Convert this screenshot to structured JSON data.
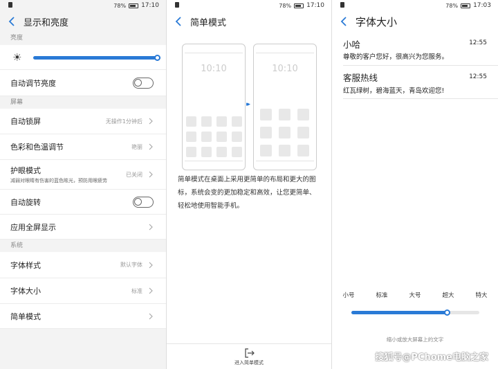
{
  "panel1": {
    "status": {
      "battery": "78%",
      "time": "17:10"
    },
    "title": "显示和亮度",
    "brightness_section": "亮度",
    "brightness_level": 1.0,
    "auto_brightness": {
      "label": "自动调节亮度",
      "on": false
    },
    "screen_section": "屏幕",
    "auto_lock": {
      "label": "自动锁屏",
      "value": "无操作1分钟后"
    },
    "color_temp": {
      "label": "色彩和色温调节",
      "value": "艳丽"
    },
    "eye_care": {
      "label": "护眼模式",
      "sub": "减弱对眼睛有伤害的蓝色眩光，预防用眼疲劳",
      "value": "已关闭"
    },
    "auto_rotate": {
      "label": "自动旋转",
      "on": false
    },
    "fullscreen": {
      "label": "应用全屏显示"
    },
    "system_section": "系统",
    "font_style": {
      "label": "字体样式",
      "value": "默认字体"
    },
    "font_size": {
      "label": "字体大小",
      "value": "标准"
    },
    "simple_mode": {
      "label": "简单模式"
    }
  },
  "panel2": {
    "status": {
      "battery": "78%",
      "time": "17:10"
    },
    "title": "简单模式",
    "clock_left": "10:10",
    "clock_right": "10:10",
    "description": "简单模式在桌面上采用更简单的布局和更大的图标，系统会变的更加稳定和高效，让您更简单、轻松地使用智能手机。",
    "enter_button": "进入简单模式"
  },
  "panel3": {
    "status": {
      "battery": "78%",
      "time": "17:03"
    },
    "title": "字体大小",
    "messages": [
      {
        "name": "小哈",
        "time": "12:55",
        "text": "尊敬的客户您好，很高兴为您服务。"
      },
      {
        "name": "客服热线",
        "time": "12:55",
        "text": "红瓦绿树，碧海蓝天，青岛欢迎您!"
      }
    ],
    "size_options": [
      "小号",
      "标准",
      "大号",
      "超大",
      "特大"
    ],
    "size_level": 0.75,
    "hint": "缩小或放大屏幕上的文字"
  },
  "watermark": "搜狐号@PChome电脑之家",
  "accent_color": "#2a7ad6"
}
